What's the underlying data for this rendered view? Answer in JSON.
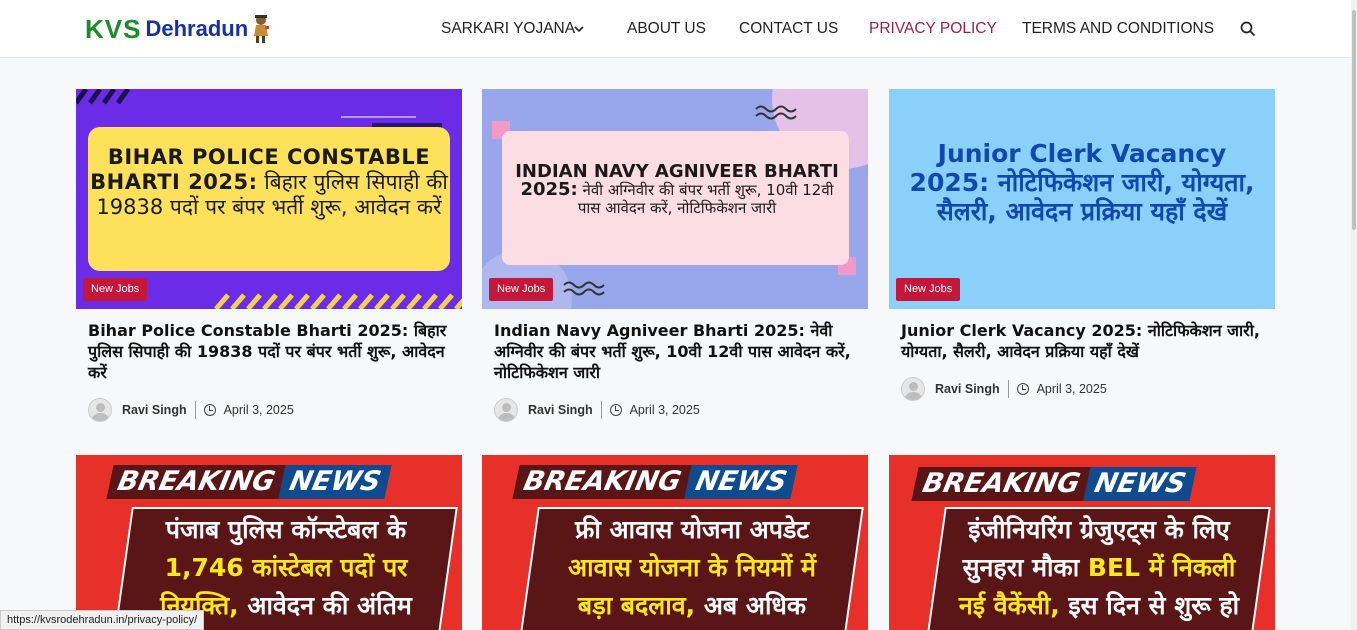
{
  "logo": {
    "part1": "KVS",
    "part2": "Dehradun"
  },
  "nav": {
    "items": [
      "SARKARI YOJANA",
      "ABOUT US",
      "CONTACT US",
      "PRIVACY POLICY",
      "TERMS AND CONDITIONS"
    ],
    "active_index": 3
  },
  "colors": {
    "accent": "#9b2141",
    "badge": "#c4173a",
    "breaking_red": "#e8302a"
  },
  "cards": [
    {
      "image_title_en": "BIHAR POLICE CONSTABLE BHARTI 2025:",
      "image_title_hi": "बिहार पुलिस सिपाही की 19838 पदों पर बंपर भर्ती शुरू, आवेदन करें",
      "category": "New Jobs",
      "title": "Bihar Police Constable Bharti 2025: बिहार पुलिस सिपाही की 19838 पदों पर बंपर भर्ती शुरू, आवेदन करें",
      "author": "Ravi Singh",
      "date": "April 3, 2025"
    },
    {
      "image_title_en": "INDIAN NAVY AGNIVEER BHARTI 2025:",
      "image_title_hi": "नेवी अग्निवीर की बंपर भर्ती शुरू, 10वी 12वी पास आवेदन करें, नोटिफिकेशन जारी",
      "category": "New Jobs",
      "title": "Indian Navy Agniveer Bharti 2025: नेवी अग्निवीर की बंपर भर्ती शुरू, 10वी 12वी पास आवेदन करें, नोटिफिकेशन जारी",
      "author": "Ravi Singh",
      "date": "April 3, 2025"
    },
    {
      "image_title_en": "Junior Clerk Vacancy 2025:",
      "image_title_hi": "नोटिफिकेशन जारी, योग्यता, सैलरी, आवेदन प्रक्रिया यहाँ देखें",
      "category": "New Jobs",
      "title": "Junior Clerk Vacancy 2025: नोटिफिकेशन जारी, योग्यता, सैलरी, आवेदन प्रक्रिया यहाँ देखें",
      "author": "Ravi Singh",
      "date": "April 3, 2025"
    }
  ],
  "breaking": {
    "label1": "BREAKING",
    "label2": "NEWS",
    "cards": [
      {
        "l1": "पंजाब पुलिस कॉन्स्टेबल के",
        "l2": "1,746 कांस्टेबल पदों पर",
        "l3a": "नियुक्ति,",
        "l3b": " आवेदन की अंतिम"
      },
      {
        "l1": "फ्री आवास योजना अपडेट",
        "l2": "आवास योजना के नियमों में",
        "l3a": "बड़ा बदलाव,",
        "l3b": " अब अधिक"
      },
      {
        "l1": "इंजीनियरिंग ग्रेजुएट्स के लिए",
        "l2a": "सुनहरा मौका ",
        "l2b": "BEL में निकली",
        "l3a": "नई वैकेंसी,",
        "l3b": " इस दिन से शुरू हो"
      }
    ]
  },
  "status_url": "https://kvsrodehradun.in/privacy-policy/"
}
